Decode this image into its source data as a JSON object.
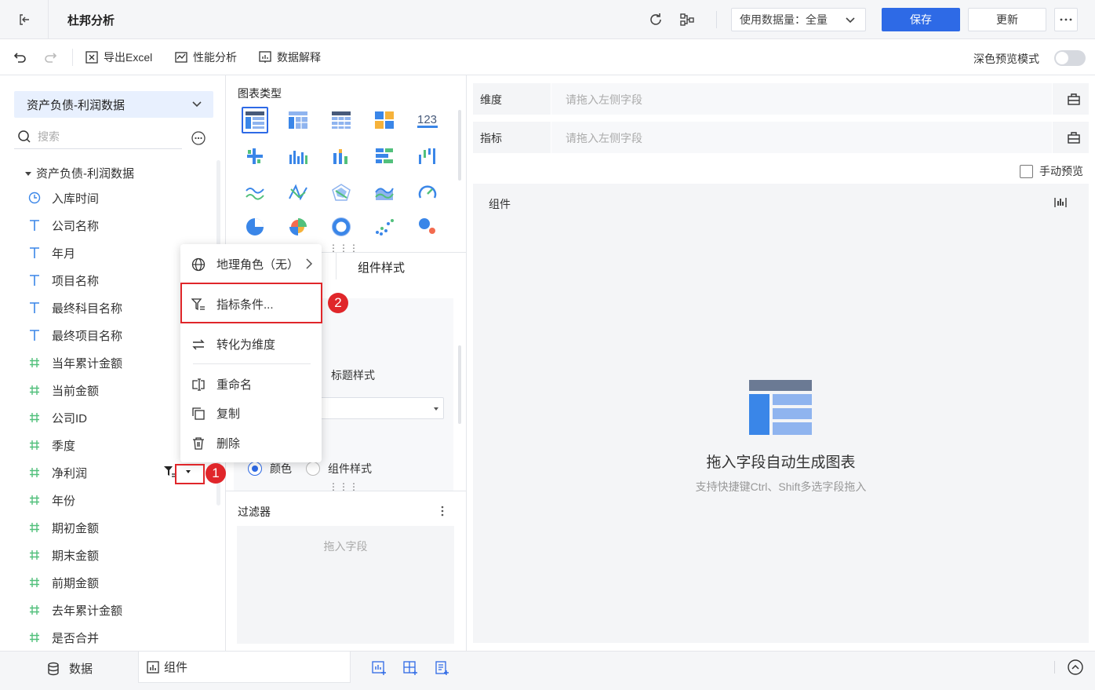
{
  "header": {
    "title": "杜邦分析",
    "usage_label": "使用数据量：全量",
    "save_label": "保存",
    "update_label": "更新"
  },
  "toolbar": {
    "export_excel": "导出Excel",
    "performance": "性能分析",
    "data_explain": "数据解释",
    "dark_preview": "深色预览模式"
  },
  "left_panel": {
    "dataset_name": "资产负债-利润数据",
    "search_placeholder": "搜索",
    "tree_root": "资产负债-利润数据",
    "fields": [
      {
        "type": "time",
        "name": "入库时间"
      },
      {
        "type": "text",
        "name": "公司名称"
      },
      {
        "type": "text",
        "name": "年月"
      },
      {
        "type": "text",
        "name": "项目名称"
      },
      {
        "type": "text",
        "name": "最终科目名称"
      },
      {
        "type": "text",
        "name": "最终项目名称"
      },
      {
        "type": "number",
        "name": "当年累计金额"
      },
      {
        "type": "number",
        "name": "当前金额"
      },
      {
        "type": "number",
        "name": "公司ID"
      },
      {
        "type": "number",
        "name": "季度"
      },
      {
        "type": "number",
        "name": "净利润"
      },
      {
        "type": "number",
        "name": "年份"
      },
      {
        "type": "number",
        "name": "期初金额"
      },
      {
        "type": "number",
        "name": "期末金额"
      },
      {
        "type": "number",
        "name": "前期金额"
      },
      {
        "type": "number",
        "name": "去年累计金额"
      },
      {
        "type": "number",
        "name": "是否合并"
      }
    ]
  },
  "middle_panel": {
    "chart_types_title": "图表类型",
    "tab_component_style": "组件样式",
    "title_style": "标题样式",
    "radio_color": "颜色",
    "radio_component_style": "组件样式",
    "filter_title": "过滤器",
    "filter_placeholder": "拖入字段"
  },
  "right_panel": {
    "dimension_label": "维度",
    "dimension_placeholder": "请拖入左侧字段",
    "metric_label": "指标",
    "metric_placeholder": "请拖入左侧字段",
    "manual_preview": "手动预览",
    "component_title": "组件",
    "empty_main": "拖入字段自动生成图表",
    "empty_sub": "支持快捷键Ctrl、Shift多选字段拖入"
  },
  "bottom_bar": {
    "tab_data": "数据",
    "tab_component": "组件"
  },
  "context_menu": {
    "geo_role": "地理角色（无）",
    "metric_condition": "指标条件...",
    "to_dimension": "转化为维度",
    "rename": "重命名",
    "copy": "复制",
    "delete": "删除"
  },
  "annotations": {
    "badge_1": "1",
    "badge_2": "2"
  },
  "colors": {
    "primary": "#2e6ae6",
    "highlight": "#e0262a",
    "field_icon": "#3a86e8"
  }
}
